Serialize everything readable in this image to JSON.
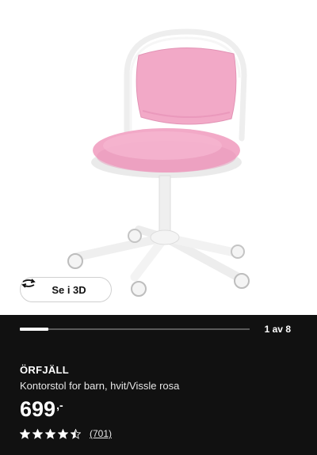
{
  "product_image": {
    "colors": {
      "frame": "#f4f4f4",
      "cushion": "#f2a9c7",
      "cushion_shade": "#e58fb4"
    },
    "view_3d_button": {
      "label": "Se i 3D",
      "icon": "rotate-3d-icon"
    }
  },
  "carousel": {
    "current": 1,
    "total": 8,
    "counter_text": "1 av 8",
    "progress": 0.125
  },
  "product": {
    "name": "ÖRFJÄLL",
    "description": "Kontorstol for barn, hvit/Vissle rosa",
    "price": "699",
    "price_suffix": ",-",
    "rating": {
      "value": 4.5,
      "max": 5,
      "reviews_text": "(701)"
    }
  }
}
